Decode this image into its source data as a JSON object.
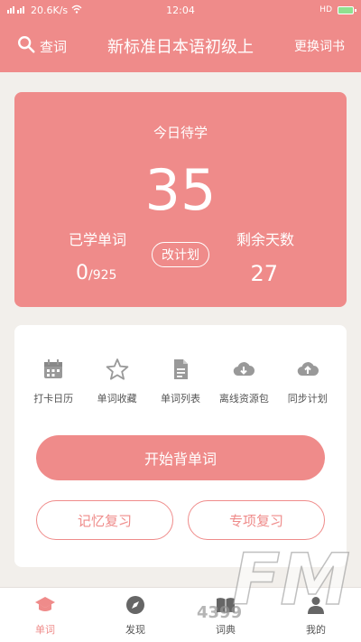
{
  "status_bar": {
    "network": "20.6K/s",
    "time": "12:04",
    "hd": "HD"
  },
  "header": {
    "search_label": "查词",
    "title": "新标准日本语初级上",
    "switch_label": "更换词书"
  },
  "stats": {
    "today_label": "今日待学",
    "today_count": "35",
    "learned_label": "已学单词",
    "learned_count": "0",
    "learned_total": "/925",
    "plan_button": "改计划",
    "remaining_label": "剩余天数",
    "remaining_days": "27"
  },
  "tools": [
    {
      "label": "打卡日历",
      "icon": "calendar-icon"
    },
    {
      "label": "单词收藏",
      "icon": "star-icon"
    },
    {
      "label": "单词列表",
      "icon": "document-icon"
    },
    {
      "label": "离线资源包",
      "icon": "cloud-download-icon"
    },
    {
      "label": "同步计划",
      "icon": "cloud-upload-icon"
    }
  ],
  "actions": {
    "start": "开始背单词",
    "memory_review": "记忆复习",
    "special_review": "专项复习"
  },
  "nav": [
    {
      "label": "单词",
      "icon": "graduation-cap-icon",
      "active": true
    },
    {
      "label": "发现",
      "icon": "compass-icon",
      "active": false
    },
    {
      "label": "词典",
      "icon": "book-icon",
      "active": false
    },
    {
      "label": "我的",
      "icon": "person-icon",
      "active": false
    }
  ],
  "watermark": {
    "text": "FM",
    "sub": "4399"
  },
  "colors": {
    "accent": "#ef8b8a",
    "background": "#f2efeb",
    "icon_gray": "#999999"
  }
}
